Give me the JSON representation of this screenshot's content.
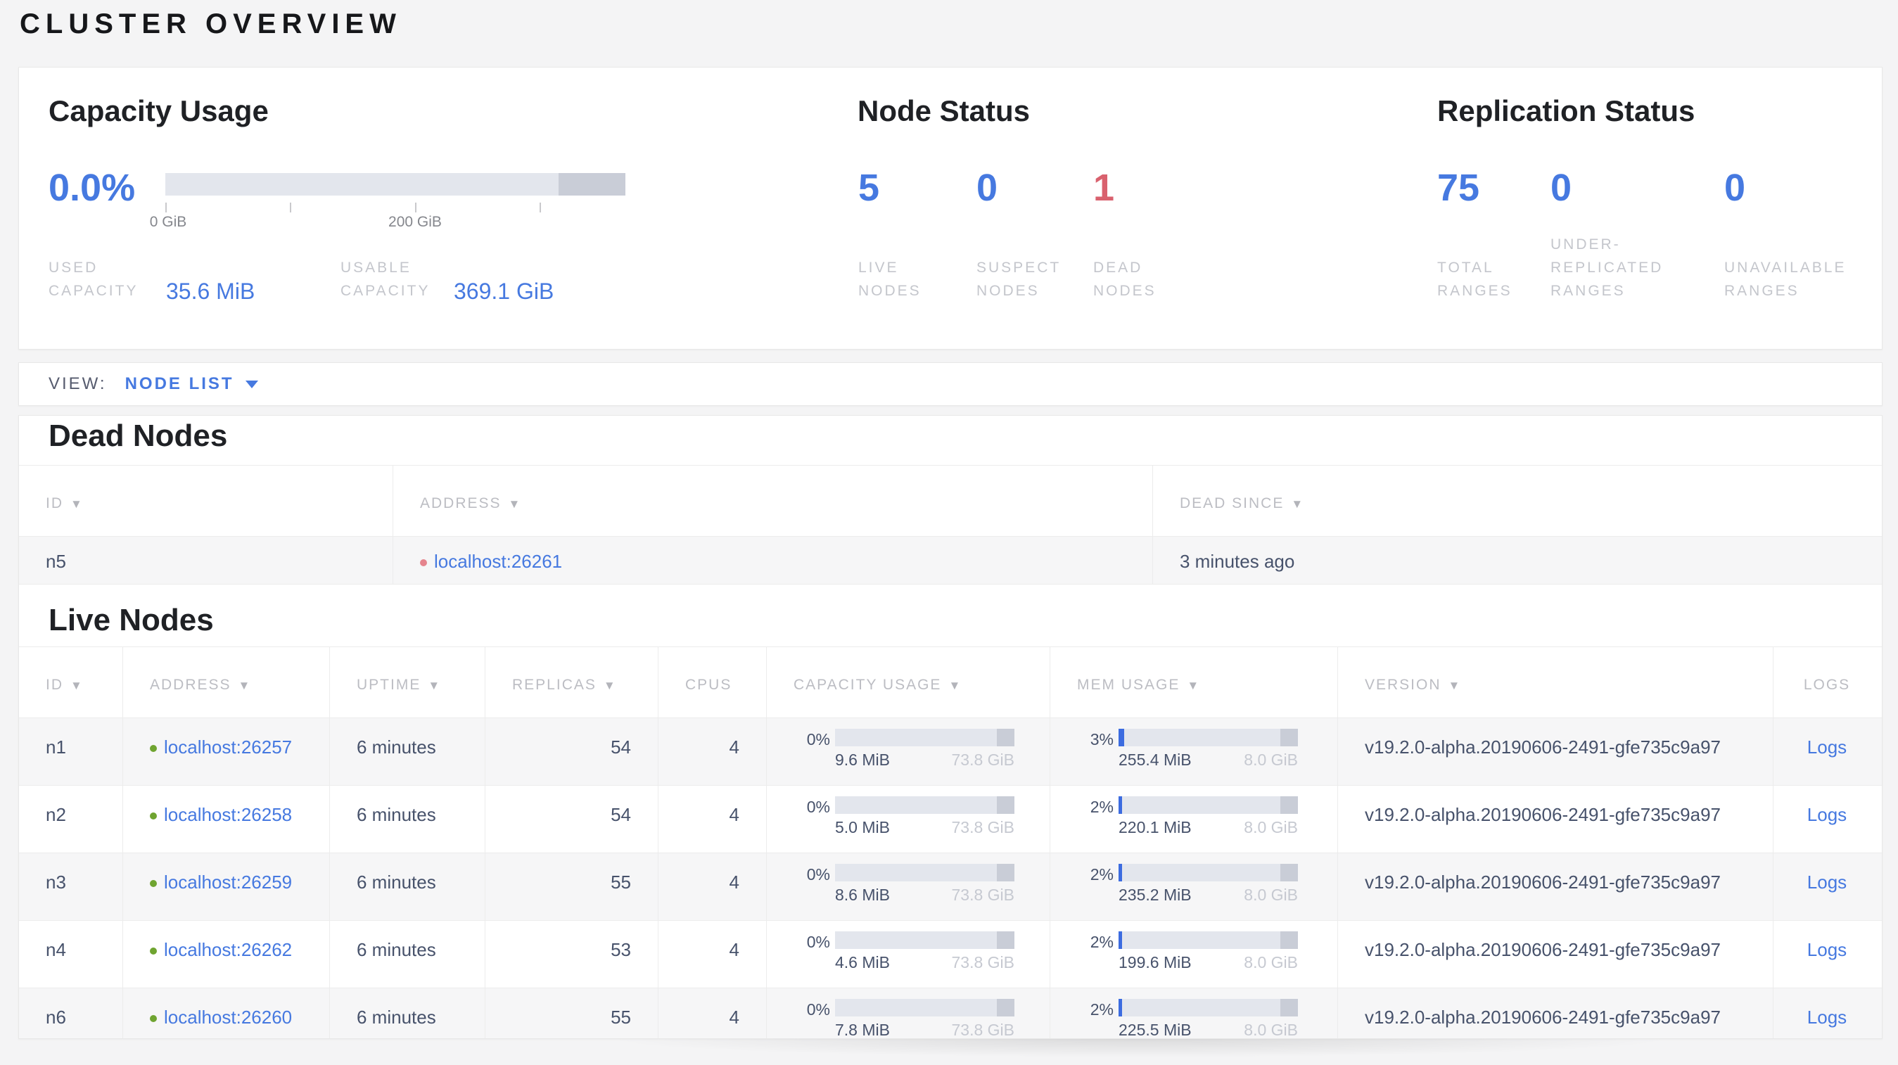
{
  "page_title": "CLUSTER OVERVIEW",
  "colors": {
    "accent_blue": "#4679e0",
    "danger_red": "#d9616e",
    "live_green": "#6fa430",
    "bar_track": "#e3e6ed",
    "bar_tail": "#c9cdd7"
  },
  "summary": {
    "capacity": {
      "title": "Capacity Usage",
      "percent": "0.0%",
      "tick_labels": [
        "0 GiB",
        "200 GiB"
      ],
      "used_label": "USED CAPACITY",
      "used_value": "35.6 MiB",
      "usable_label": "USABLE CAPACITY",
      "usable_value": "369.1 GiB"
    },
    "node_status": {
      "title": "Node Status",
      "stats": [
        {
          "value": "5",
          "label": "LIVE NODES"
        },
        {
          "value": "0",
          "label": "SUSPECT NODES"
        },
        {
          "value": "1",
          "label": "DEAD NODES"
        }
      ]
    },
    "replication": {
      "title": "Replication Status",
      "stats": [
        {
          "value": "75",
          "label": "TOTAL RANGES"
        },
        {
          "value": "0",
          "label": "UNDER-REPLICATED RANGES"
        },
        {
          "value": "0",
          "label": "UNAVAILABLE RANGES"
        }
      ]
    }
  },
  "view_bar": {
    "label": "VIEW:",
    "selected": "NODE LIST"
  },
  "dead_nodes": {
    "title": "Dead Nodes",
    "columns": [
      {
        "label": "ID"
      },
      {
        "label": "ADDRESS"
      },
      {
        "label": "DEAD SINCE"
      }
    ],
    "rows": [
      {
        "id": "n5",
        "address": "localhost:26261",
        "dead_since": "3 minutes ago"
      }
    ]
  },
  "live_nodes": {
    "title": "Live Nodes",
    "columns": [
      {
        "label": "ID"
      },
      {
        "label": "ADDRESS"
      },
      {
        "label": "UPTIME"
      },
      {
        "label": "REPLICAS"
      },
      {
        "label": "CPUS"
      },
      {
        "label": "CAPACITY USAGE"
      },
      {
        "label": "MEM USAGE"
      },
      {
        "label": "VERSION"
      },
      {
        "label": "LOGS"
      }
    ],
    "logs_label": "Logs",
    "rows": [
      {
        "id": "n1",
        "address": "localhost:26257",
        "uptime": "6 minutes",
        "replicas": "54",
        "cpus": "4",
        "cap_pct": "0%",
        "cap_used": "9.6 MiB",
        "cap_total": "73.8 GiB",
        "mem_pct": "3%",
        "mem_used": "255.4 MiB",
        "mem_total": "8.0 GiB",
        "version": "v19.2.0-alpha.20190606-2491-gfe735c9a97"
      },
      {
        "id": "n2",
        "address": "localhost:26258",
        "uptime": "6 minutes",
        "replicas": "54",
        "cpus": "4",
        "cap_pct": "0%",
        "cap_used": "5.0 MiB",
        "cap_total": "73.8 GiB",
        "mem_pct": "2%",
        "mem_used": "220.1 MiB",
        "mem_total": "8.0 GiB",
        "version": "v19.2.0-alpha.20190606-2491-gfe735c9a97"
      },
      {
        "id": "n3",
        "address": "localhost:26259",
        "uptime": "6 minutes",
        "replicas": "55",
        "cpus": "4",
        "cap_pct": "0%",
        "cap_used": "8.6 MiB",
        "cap_total": "73.8 GiB",
        "mem_pct": "2%",
        "mem_used": "235.2 MiB",
        "mem_total": "8.0 GiB",
        "version": "v19.2.0-alpha.20190606-2491-gfe735c9a97"
      },
      {
        "id": "n4",
        "address": "localhost:26262",
        "uptime": "6 minutes",
        "replicas": "53",
        "cpus": "4",
        "cap_pct": "0%",
        "cap_used": "4.6 MiB",
        "cap_total": "73.8 GiB",
        "mem_pct": "2%",
        "mem_used": "199.6 MiB",
        "mem_total": "8.0 GiB",
        "version": "v19.2.0-alpha.20190606-2491-gfe735c9a97"
      },
      {
        "id": "n6",
        "address": "localhost:26260",
        "uptime": "6 minutes",
        "replicas": "55",
        "cpus": "4",
        "cap_pct": "0%",
        "cap_used": "7.8 MiB",
        "cap_total": "73.8 GiB",
        "mem_pct": "2%",
        "mem_used": "225.5 MiB",
        "mem_total": "8.0 GiB",
        "version": "v19.2.0-alpha.20190606-2491-gfe735c9a97"
      }
    ]
  }
}
